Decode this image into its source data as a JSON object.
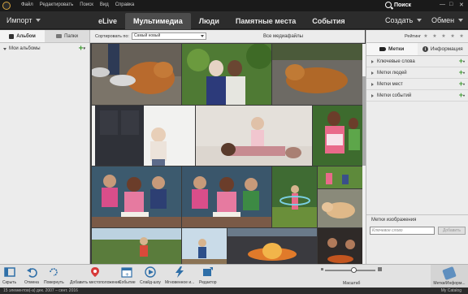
{
  "menubar": {
    "menus": [
      "Файл",
      "Редактировать",
      "Поиск",
      "Вид",
      "Справка"
    ],
    "search_label": "Поиск"
  },
  "modebar": {
    "import_label": "Импорт",
    "tabs": [
      "eLive",
      "Мультимедиа",
      "Люди",
      "Памятные места",
      "События"
    ],
    "active_tab": "Мультимедиа",
    "create_label": "Создать",
    "share_label": "Обмен"
  },
  "left_panel": {
    "tabs": [
      "Альбом",
      "Папки"
    ],
    "active_tab": "Альбом",
    "albums_header": "Мои альбомы"
  },
  "grid_toolbar": {
    "sort_label": "Сортировать по:",
    "sort_value": "Самый новый",
    "view_label": "Все медиафайлы"
  },
  "right_panel": {
    "rating_label": "Рейтинг",
    "stars": "★ ★ ★ ★ ★",
    "tabs": [
      "Метки",
      "Информация"
    ],
    "active_tab": "Метки",
    "tag_groups": [
      "Ключевые слова",
      "Метки людей",
      "Метки мест",
      "Метки событий"
    ],
    "image_tags_label": "Метки изображения",
    "keyword_placeholder": "Ключевое слово",
    "add_button": "Добавить"
  },
  "bottom_toolbar": {
    "buttons": [
      {
        "label": "Скрыть",
        "icon": "panel-icon"
      },
      {
        "label": "Отмена",
        "icon": "undo-icon"
      },
      {
        "label": "Повернуть",
        "icon": "rotate-icon"
      },
      {
        "label": "Добавить местоположение",
        "icon": "location-pin-icon"
      },
      {
        "label": "Событие",
        "icon": "event-icon"
      },
      {
        "label": "Слайд-шоу",
        "icon": "play-icon"
      },
      {
        "label": "Мгновенное и...",
        "icon": "lightning-icon"
      },
      {
        "label": "Редактор",
        "icon": "editor-icon"
      }
    ],
    "zoom_label": "Масштаб",
    "meta_button": "Метки/Информ..."
  },
  "statusbar": {
    "left": "15 элементов(-а) дек. 2007 – сент. 2016",
    "right": "My Catalog"
  },
  "colors": {
    "accent_green": "#3d9b2f",
    "dark_chrome": "#2c2c2c",
    "active_tab": "#4c4c4c",
    "panel_bg": "#ececec"
  }
}
